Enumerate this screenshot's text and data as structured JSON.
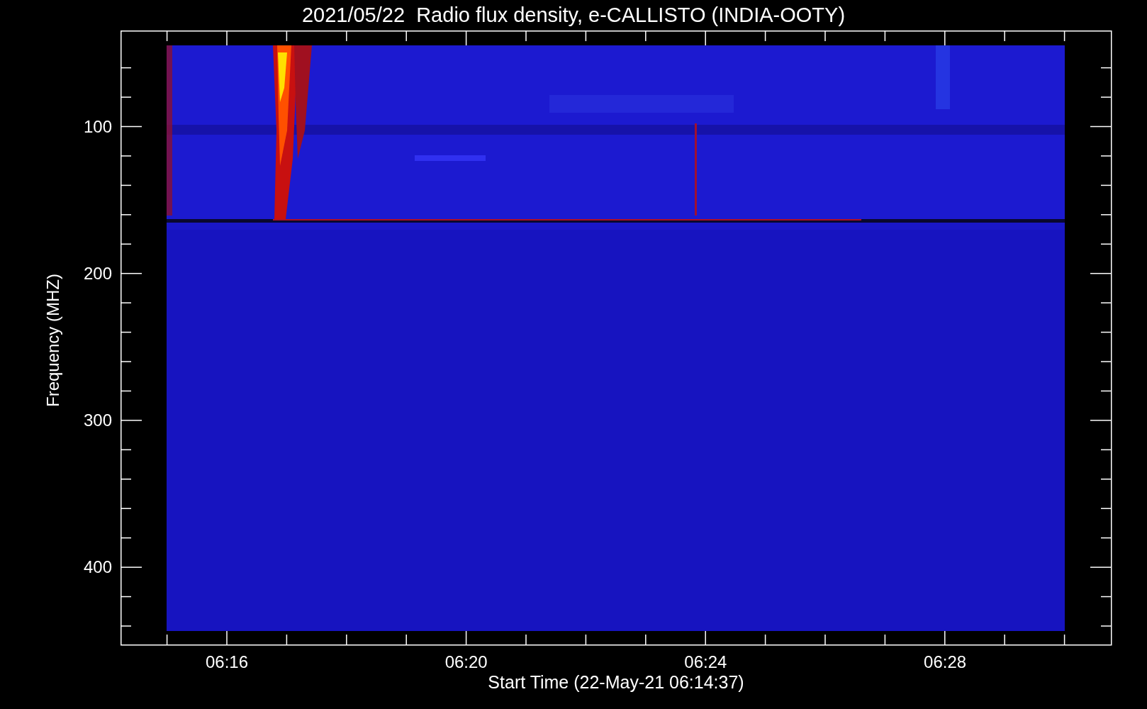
{
  "title": "2021/05/22  Radio flux density, e-CALLISTO (INDIA-OOTY)",
  "y_axis": {
    "label": "Frequency (MHZ)",
    "ticks": [
      "100",
      "200",
      "300",
      "400"
    ]
  },
  "x_axis": {
    "label": "Start Time (22-May-21 06:14:37)",
    "ticks": [
      "06:16",
      "06:20",
      "06:24",
      "06:28"
    ]
  }
}
